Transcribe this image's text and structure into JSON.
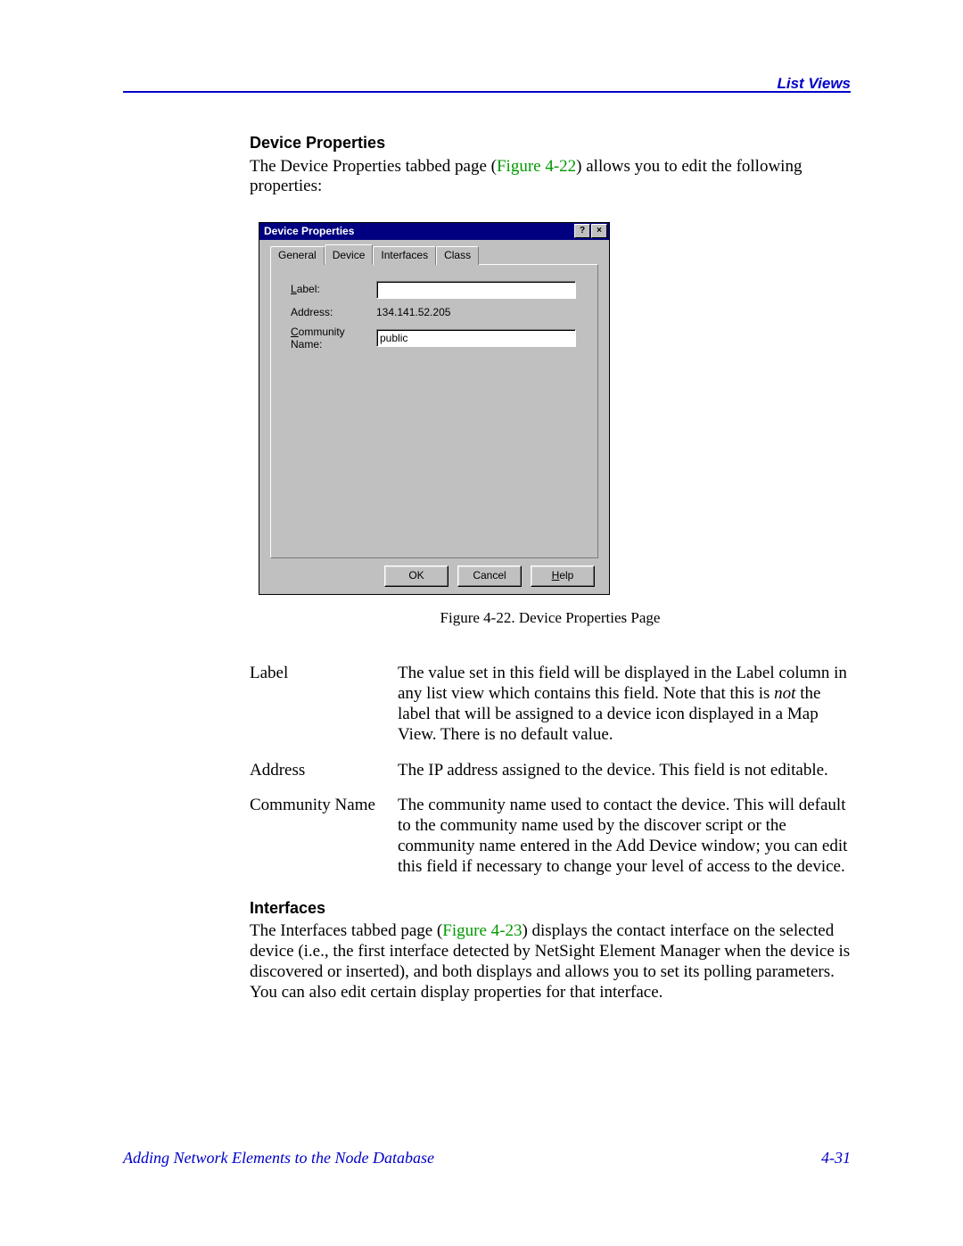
{
  "header": {
    "right_label": "List Views"
  },
  "section1": {
    "title": "Device Properties",
    "para_before": "The Device Properties tabbed page (",
    "fig_ref": "Figure 4-22",
    "para_after": ") allows you to edit the following properties:"
  },
  "dialog": {
    "title": "Device Properties",
    "help_glyph": "?",
    "close_glyph": "×",
    "tabs": [
      "General",
      "Device",
      "Interfaces",
      "Class"
    ],
    "active_tab_index": 1,
    "fields": {
      "label_label_pre": "L",
      "label_label_post": "abel:",
      "label_value": "",
      "address_label": "Address:",
      "address_value": "134.141.52.205",
      "comm_label_pre": "C",
      "comm_label_post": "ommunity Name:",
      "comm_value": "public"
    },
    "buttons": {
      "ok": "OK",
      "cancel": "Cancel",
      "help_pre": "H",
      "help_post": "elp"
    }
  },
  "figure_caption": "Figure 4-22.  Device Properties Page",
  "definitions": [
    {
      "term": "Label",
      "desc_parts": [
        "The value set in this field will be displayed in the Label column in any list view which contains this field. Note that this is ",
        "not",
        " the label that will be assigned to a device icon displayed in a Map View. There is no default value."
      ]
    },
    {
      "term": "Address",
      "desc": "The IP address assigned to the device. This field is not editable."
    },
    {
      "term": "Community Name",
      "desc": "The community name used to contact the device. This will default to the community name used by the discover script or the community name entered in the Add Device window; you can edit this field if necessary to change your level of access to the device."
    }
  ],
  "section2": {
    "title": "Interfaces",
    "para_before": "The Interfaces tabbed page (",
    "fig_ref": "Figure 4-23",
    "para_after": ") displays the contact interface on the selected device (i.e., the first interface detected by NetSight Element Manager when the device is discovered or inserted), and both displays and allows you to set its polling parameters. You can also edit certain display properties for that interface."
  },
  "footer": {
    "left": "Adding Network Elements to the Node Database",
    "right": "4-31"
  }
}
